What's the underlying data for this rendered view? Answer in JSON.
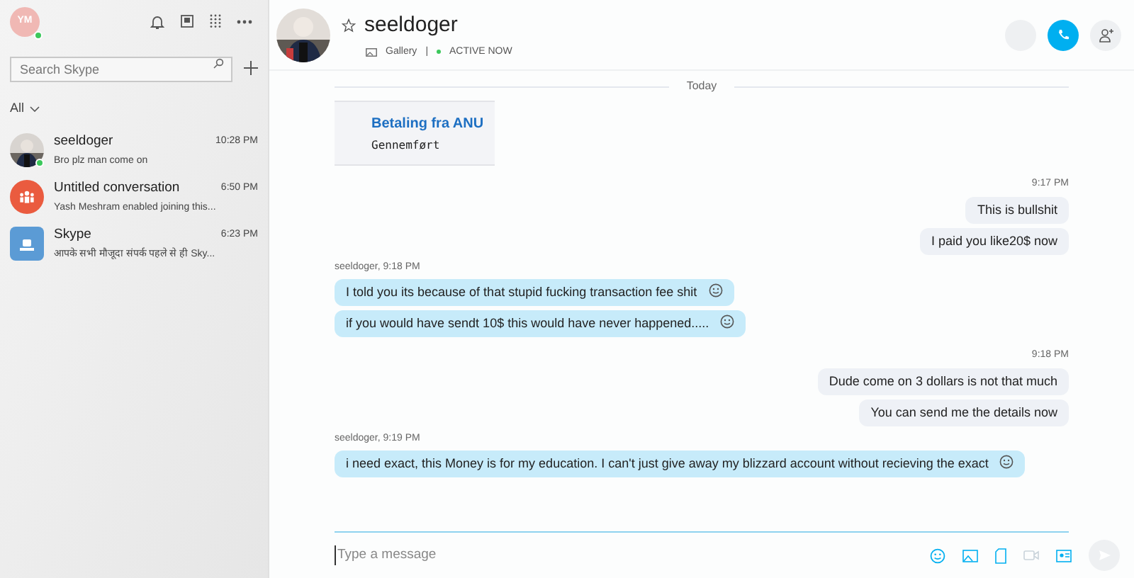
{
  "profile": {
    "initials": "YM",
    "online": true
  },
  "search": {
    "placeholder": "Search Skype"
  },
  "filter": {
    "label": "All"
  },
  "conversations": [
    {
      "name": "seeldoger",
      "time": "10:28 PM",
      "preview": "Bro plz man come on",
      "online": true
    },
    {
      "name": "Untitled conversation",
      "time": "6:50 PM",
      "preview": "Yash Meshram enabled joining this...",
      "kind": "group",
      "online": false
    },
    {
      "name": "Skype",
      "time": "6:23 PM",
      "preview": "आपके सभी मौजूदा संपर्क पहले से ही Sky...",
      "kind": "bot",
      "online": false
    }
  ],
  "chat": {
    "name": "seeldoger",
    "gallery": "Gallery",
    "separator": "|",
    "status": "ACTIVE NOW",
    "favorite": false
  },
  "items": [
    {
      "kind": "divider",
      "text": "Today"
    },
    {
      "kind": "card",
      "title": "Betaling fra ANU",
      "subtitle": "Gennemført"
    },
    {
      "kind": "outgoing",
      "meta": "9:17 PM",
      "messages": [
        {
          "text": "This is bullshit",
          "reaction": false
        },
        {
          "text": "I paid you like20$ now",
          "reaction": false
        }
      ]
    },
    {
      "kind": "incoming",
      "meta": "seeldoger, 9:18 PM",
      "messages": [
        {
          "text": "I told you its because of that stupid fucking transaction fee shit",
          "reaction": true
        },
        {
          "text": "if you would have sendt 10$ this would have never happened.....",
          "reaction": true
        }
      ]
    },
    {
      "kind": "outgoing",
      "meta": "9:18 PM",
      "messages": [
        {
          "text": "Dude come on 3 dollars is not that much",
          "reaction": false
        },
        {
          "text": "You can send me the details now",
          "reaction": false
        }
      ]
    },
    {
      "kind": "incoming",
      "meta": "seeldoger, 9:19 PM",
      "messages": [
        {
          "text": "i need exact, this Money is for my education. I can't just give away my blizzard account without recieving the exact",
          "reaction": true
        }
      ]
    }
  ],
  "composer": {
    "placeholder": "Type a message"
  }
}
